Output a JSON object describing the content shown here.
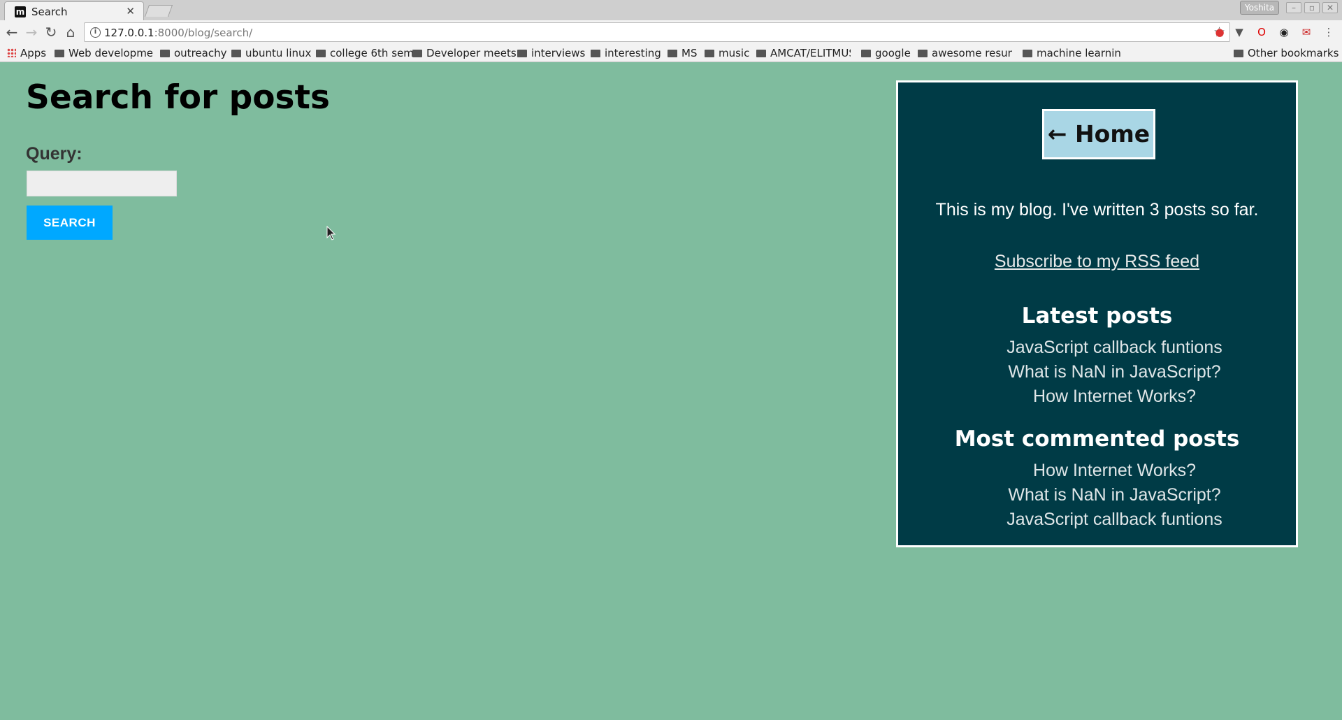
{
  "browser": {
    "tab_title": "Search",
    "tab_favicon": "m",
    "user_name": "Yoshita",
    "url_host": "127.0.0.1",
    "url_rest": ":8000/blog/search/",
    "bookmarks": [
      {
        "label": "Apps",
        "icon": "apps-icon"
      },
      {
        "label": "Web developme",
        "icon": "folder-icon"
      },
      {
        "label": "outreachy",
        "icon": "folder-icon"
      },
      {
        "label": "ubuntu linux",
        "icon": "folder-icon"
      },
      {
        "label": "college 6th sem",
        "icon": "folder-icon"
      },
      {
        "label": "Developer meets",
        "icon": "folder-icon"
      },
      {
        "label": "interviews",
        "icon": "folder-icon"
      },
      {
        "label": "interesting",
        "icon": "folder-icon"
      },
      {
        "label": "MS",
        "icon": "folder-icon"
      },
      {
        "label": "music",
        "icon": "folder-icon"
      },
      {
        "label": "AMCAT/ELITMUS",
        "icon": "folder-icon"
      },
      {
        "label": "google",
        "icon": "folder-icon"
      },
      {
        "label": "awesome resum",
        "icon": "folder-icon"
      },
      {
        "label": "machine learning",
        "icon": "folder-icon"
      }
    ],
    "other_bookmarks": "Other bookmarks"
  },
  "page": {
    "title": "Search for posts",
    "query_label": "Query:",
    "query_value": "",
    "search_button": "Search"
  },
  "sidebar": {
    "home_button": "← Home",
    "description": "This is my blog. I've written 3 posts so far.",
    "rss_link": "Subscribe to my RSS feed",
    "latest_title": "Latest posts",
    "latest_posts": [
      "JavaScript callback funtions",
      "What is NaN in JavaScript?",
      "How Internet Works?"
    ],
    "commented_title": "Most commented posts",
    "commented_posts": [
      "How Internet Works?",
      "What is NaN in JavaScript?",
      "JavaScript callback funtions"
    ]
  },
  "colors": {
    "page_background": "#7fbc9e",
    "sidebar_background": "#003b46",
    "search_button": "#00a8ff",
    "home_button": "#a9d6e5"
  }
}
